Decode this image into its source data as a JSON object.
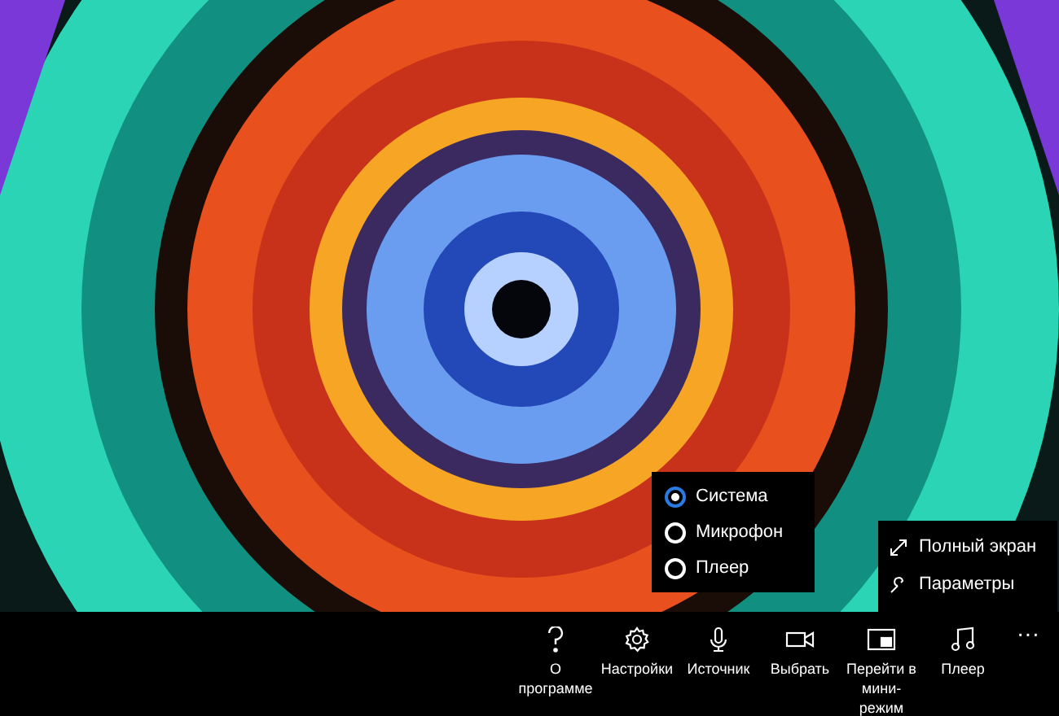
{
  "source_menu": {
    "options": [
      {
        "label": "Система",
        "selected": true
      },
      {
        "label": "Микрофон",
        "selected": false
      },
      {
        "label": "Плеер",
        "selected": false
      }
    ]
  },
  "more_menu": {
    "items": [
      {
        "kind": "fullscreen",
        "label": "Полный экран"
      },
      {
        "kind": "settings",
        "label": "Параметры"
      }
    ]
  },
  "app_bar": {
    "buttons": [
      {
        "kind": "help",
        "label": "О программе"
      },
      {
        "kind": "settings",
        "label": "Настройки"
      },
      {
        "kind": "mic",
        "label": "Источник"
      },
      {
        "kind": "camera",
        "label": "Выбрать"
      },
      {
        "kind": "pip",
        "label": "Перейти в мини-режим"
      },
      {
        "kind": "music",
        "label": "Плеер"
      }
    ],
    "more_glyph": "···"
  }
}
